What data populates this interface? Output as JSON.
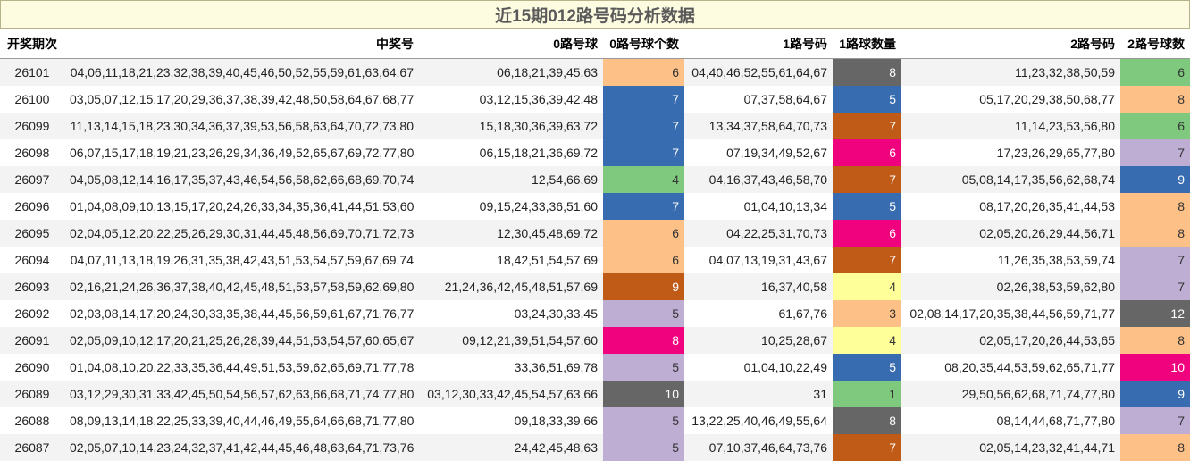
{
  "title": "近15期012路号码分析数据",
  "headers": [
    "开奖期次",
    "中奖号",
    "0路号球",
    "0路号球个数",
    "1路号码",
    "1路球数量",
    "2路号码",
    "2路号球数"
  ],
  "count_colors": {
    "1": "#7fc97f",
    "3": "#fdc086",
    "4": "#ffff99",
    "5": "#beaed4",
    "6": "#fdc086",
    "7": "#386cb0",
    "8": "#f0027f",
    "9": "#bf5b17",
    "10": "#666666",
    "12": "#666666"
  },
  "rows": [
    {
      "issue": "26101",
      "numbers": "04,06,11,18,21,23,32,38,39,40,45,46,50,52,55,59,61,63,64,67",
      "r0": "06,18,21,39,45,63",
      "c0": "6",
      "c0_color": "#fdc086",
      "r1": "04,40,46,52,55,61,64,67",
      "c1": "8",
      "c1_color": "#666666",
      "r2": "11,23,32,38,50,59",
      "c2": "6",
      "c2_color": "#7fc97f"
    },
    {
      "issue": "26100",
      "numbers": "03,05,07,12,15,17,20,29,36,37,38,39,42,48,50,58,64,67,68,77",
      "r0": "03,12,15,36,39,42,48",
      "c0": "7",
      "c0_color": "#386cb0",
      "r1": "07,37,58,64,67",
      "c1": "5",
      "c1_color": "#386cb0",
      "r2": "05,17,20,29,38,50,68,77",
      "c2": "8",
      "c2_color": "#fdc086"
    },
    {
      "issue": "26099",
      "numbers": "11,13,14,15,18,23,30,34,36,37,39,53,56,58,63,64,70,72,73,80",
      "r0": "15,18,30,36,39,63,72",
      "c0": "7",
      "c0_color": "#386cb0",
      "r1": "13,34,37,58,64,70,73",
      "c1": "7",
      "c1_color": "#bf5b17",
      "r2": "11,14,23,53,56,80",
      "c2": "6",
      "c2_color": "#7fc97f"
    },
    {
      "issue": "26098",
      "numbers": "06,07,15,17,18,19,21,23,26,29,34,36,49,52,65,67,69,72,77,80",
      "r0": "06,15,18,21,36,69,72",
      "c0": "7",
      "c0_color": "#386cb0",
      "r1": "07,19,34,49,52,67",
      "c1": "6",
      "c1_color": "#f0027f",
      "r2": "17,23,26,29,65,77,80",
      "c2": "7",
      "c2_color": "#beaed4"
    },
    {
      "issue": "26097",
      "numbers": "04,05,08,12,14,16,17,35,37,43,46,54,56,58,62,66,68,69,70,74",
      "r0": "12,54,66,69",
      "c0": "4",
      "c0_color": "#7fc97f",
      "r1": "04,16,37,43,46,58,70",
      "c1": "7",
      "c1_color": "#bf5b17",
      "r2": "05,08,14,17,35,56,62,68,74",
      "c2": "9",
      "c2_color": "#386cb0"
    },
    {
      "issue": "26096",
      "numbers": "01,04,08,09,10,13,15,17,20,24,26,33,34,35,36,41,44,51,53,60",
      "r0": "09,15,24,33,36,51,60",
      "c0": "7",
      "c0_color": "#386cb0",
      "r1": "01,04,10,13,34",
      "c1": "5",
      "c1_color": "#386cb0",
      "r2": "08,17,20,26,35,41,44,53",
      "c2": "8",
      "c2_color": "#fdc086"
    },
    {
      "issue": "26095",
      "numbers": "02,04,05,12,20,22,25,26,29,30,31,44,45,48,56,69,70,71,72,73",
      "r0": "12,30,45,48,69,72",
      "c0": "6",
      "c0_color": "#fdc086",
      "r1": "04,22,25,31,70,73",
      "c1": "6",
      "c1_color": "#f0027f",
      "r2": "02,05,20,26,29,44,56,71",
      "c2": "8",
      "c2_color": "#fdc086"
    },
    {
      "issue": "26094",
      "numbers": "04,07,11,13,18,19,26,31,35,38,42,43,51,53,54,57,59,67,69,74",
      "r0": "18,42,51,54,57,69",
      "c0": "6",
      "c0_color": "#fdc086",
      "r1": "04,07,13,19,31,43,67",
      "c1": "7",
      "c1_color": "#bf5b17",
      "r2": "11,26,35,38,53,59,74",
      "c2": "7",
      "c2_color": "#beaed4"
    },
    {
      "issue": "26093",
      "numbers": "02,16,21,24,26,36,37,38,40,42,45,48,51,53,57,58,59,62,69,80",
      "r0": "21,24,36,42,45,48,51,57,69",
      "c0": "9",
      "c0_color": "#bf5b17",
      "r1": "16,37,40,58",
      "c1": "4",
      "c1_color": "#ffff99",
      "r2": "02,26,38,53,59,62,80",
      "c2": "7",
      "c2_color": "#beaed4"
    },
    {
      "issue": "26092",
      "numbers": "02,03,08,14,17,20,24,30,33,35,38,44,45,56,59,61,67,71,76,77",
      "r0": "03,24,30,33,45",
      "c0": "5",
      "c0_color": "#beaed4",
      "r1": "61,67,76",
      "c1": "3",
      "c1_color": "#fdc086",
      "r2": "02,08,14,17,20,35,38,44,56,59,71,77",
      "c2": "12",
      "c2_color": "#666666"
    },
    {
      "issue": "26091",
      "numbers": "02,05,09,10,12,17,20,21,25,26,28,39,44,51,53,54,57,60,65,67",
      "r0": "09,12,21,39,51,54,57,60",
      "c0": "8",
      "c0_color": "#f0027f",
      "r1": "10,25,28,67",
      "c1": "4",
      "c1_color": "#ffff99",
      "r2": "02,05,17,20,26,44,53,65",
      "c2": "8",
      "c2_color": "#fdc086"
    },
    {
      "issue": "26090",
      "numbers": "01,04,08,10,20,22,33,35,36,44,49,51,53,59,62,65,69,71,77,78",
      "r0": "33,36,51,69,78",
      "c0": "5",
      "c0_color": "#beaed4",
      "r1": "01,04,10,22,49",
      "c1": "5",
      "c1_color": "#386cb0",
      "r2": "08,20,35,44,53,59,62,65,71,77",
      "c2": "10",
      "c2_color": "#f0027f"
    },
    {
      "issue": "26089",
      "numbers": "03,12,29,30,31,33,42,45,50,54,56,57,62,63,66,68,71,74,77,80",
      "r0": "03,12,30,33,42,45,54,57,63,66",
      "c0": "10",
      "c0_color": "#666666",
      "r1": "31",
      "c1": "1",
      "c1_color": "#7fc97f",
      "r2": "29,50,56,62,68,71,74,77,80",
      "c2": "9",
      "c2_color": "#386cb0"
    },
    {
      "issue": "26088",
      "numbers": "08,09,13,14,18,22,25,33,39,40,44,46,49,55,64,66,68,71,77,80",
      "r0": "09,18,33,39,66",
      "c0": "5",
      "c0_color": "#beaed4",
      "r1": "13,22,25,40,46,49,55,64",
      "c1": "8",
      "c1_color": "#666666",
      "r2": "08,14,44,68,71,77,80",
      "c2": "7",
      "c2_color": "#beaed4"
    },
    {
      "issue": "26087",
      "numbers": "02,05,07,10,14,23,24,32,37,41,42,44,45,46,48,63,64,71,73,76",
      "r0": "24,42,45,48,63",
      "c0": "5",
      "c0_color": "#beaed4",
      "r1": "07,10,37,46,64,73,76",
      "c1": "7",
      "c1_color": "#bf5b17",
      "r2": "02,05,14,23,32,41,44,71",
      "c2": "8",
      "c2_color": "#fdc086"
    }
  ]
}
